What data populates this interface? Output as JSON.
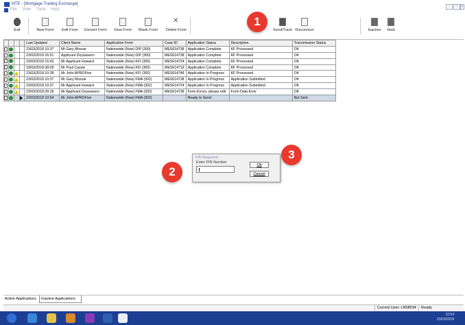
{
  "window": {
    "title": "MTE - [Mortgage Trading Exchange]",
    "menu": [
      "File",
      "View",
      "Tools",
      "Help"
    ]
  },
  "toolbar": {
    "buttons": [
      {
        "label": "Exit"
      },
      {
        "label": "New Form"
      },
      {
        "label": "Edit Form"
      },
      {
        "label": "Convert Form"
      },
      {
        "label": "View Form"
      },
      {
        "label": "Blank Form"
      },
      {
        "label": "Delete Form"
      },
      {
        "label": "Send/Track"
      },
      {
        "label": "Disconnect"
      },
      {
        "label": "Inactive"
      },
      {
        "label": "Hold"
      }
    ]
  },
  "grid": {
    "columns": [
      "Last Updated",
      "Client Name",
      "Application Form",
      "Case ID",
      "Application Status",
      "Description",
      "Transmission Status"
    ],
    "rows": [
      {
        "updated": "23/03/2018 10:37",
        "client": "Mr Gary Mossie",
        "form": "Nationwide (Now) DIP (300)",
        "case": "MES614738",
        "status": "Application Complete",
        "desc": "KF Processed",
        "tx": "OK",
        "warn": false,
        "checked": true
      },
      {
        "updated": "23/03/2018 16:51",
        "client": "Applicant Doywavern",
        "form": "Nationwide (Now) DIP (300)",
        "case": "MES614738",
        "status": "Application Complete",
        "desc": "KF Processed",
        "tx": "OK",
        "warn": false,
        "checked": false
      },
      {
        "updated": "23/03/2018 15:43",
        "client": "Mr Applicant Howard",
        "form": "Nationwide (Now) KFI (300)",
        "case": "MES614724",
        "status": "Application Complete",
        "desc": "KF Processed",
        "tx": "OK",
        "warn": false,
        "checked": true
      },
      {
        "updated": "23/03/2018 08:09",
        "client": "Mr Paul Cassie",
        "form": "Nationwide (Now) KFI (300)",
        "case": "MES614719",
        "status": "Application Complete",
        "desc": "KF Processed",
        "tx": "OK",
        "warn": false,
        "checked": true
      },
      {
        "updated": "23/03/2018 10:38",
        "client": "Mr John APROFive",
        "form": "Nationwide (Now) KFI (300)",
        "case": "MES614748",
        "status": "Application In Progress",
        "desc": "KF Processed",
        "tx": "OK",
        "warn": true,
        "checked": false
      },
      {
        "updated": "23/03/2018 10:37",
        "client": "Mr Gary Mossie",
        "form": "Nationwide (Now) FMA (302)",
        "case": "MES614738",
        "status": "Application In Progress",
        "desc": "Application Submitted",
        "tx": "OK",
        "warn": true,
        "checked": true
      },
      {
        "updated": "23/03/2018 10:37",
        "client": "Mr Applicant Howard",
        "form": "Nationwide (Now) FMA (302)",
        "case": "MES614724",
        "status": "Application In Progress",
        "desc": "Application Submitted",
        "tx": "OK",
        "warn": true,
        "checked": false
      },
      {
        "updated": "23/03/2018 09:18",
        "client": "Mr Applicant Doywavern",
        "form": "Nationwide (Now) FMA (302)",
        "case": "MES614738",
        "status": "Form Errors, please edit",
        "desc": "Form Data Error",
        "tx": "OK",
        "warn": true,
        "checked": true
      },
      {
        "updated": "23/03/2018 10:54",
        "client": "Mr John APROFive",
        "form": "Nationwide (Now) FMA (302)",
        "case": "",
        "status": "Ready to Send",
        "desc": "",
        "tx": "Not Sent",
        "warn": false,
        "checked": false,
        "selected": true
      }
    ]
  },
  "tabs": {
    "active": "Active Applications",
    "inactive": "Inactive Applications"
  },
  "status": {
    "user": "Current User: LR08034",
    "state": "Ready"
  },
  "taskbar": {
    "time": "10:54",
    "date": "23/03/2018"
  },
  "dialog": {
    "title": "FIN Required",
    "label": "Enter FIN Number",
    "value": "",
    "ok": "Ok",
    "cancel": "Cancel"
  },
  "callouts": [
    "1",
    "2",
    "3"
  ],
  "colors": {
    "callout": "#e8392e",
    "taskbar": "#1c3f94",
    "selected_row": "#cfd8e4"
  }
}
